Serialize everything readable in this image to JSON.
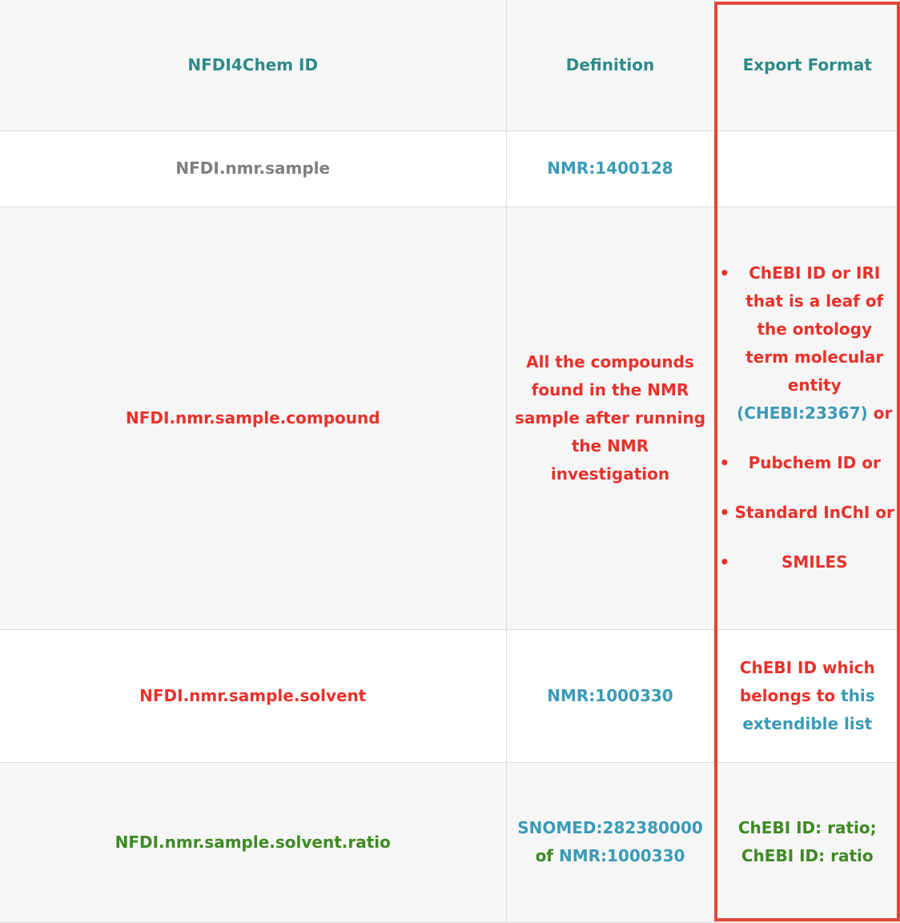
{
  "headers": {
    "col1": "NFDI4Chem ID",
    "col2": "Definition",
    "col3": "Export Format"
  },
  "rows": [
    {
      "id": "NFDI.nmr.sample",
      "definition": "NMR:1400128",
      "export": ""
    },
    {
      "id": "NFDI.nmr.sample.compound",
      "definition": "All the compounds found in the NMR sample after running the NMR investigation",
      "export_items": [
        {
          "text": "ChEBI ID or IRI that is a leaf of the ontology term molecular entity",
          "link": "(CHEBI:23367)",
          "suffix": "or"
        },
        {
          "text": "Pubchem ID or"
        },
        {
          "text": "Standard InChI or"
        },
        {
          "text": "SMILES"
        }
      ]
    },
    {
      "id": "NFDI.nmr.sample.solvent",
      "definition": "NMR:1000330",
      "export_text": "ChEBI ID which belongs to",
      "export_link": "this extendible list"
    },
    {
      "id": "NFDI.nmr.sample.solvent.ratio",
      "definition_link1": "SNOMED:282380000",
      "definition_mid": "of",
      "definition_link2": "NMR:1000330",
      "export": "ChEBI ID: ratio; ChEBI ID: ratio"
    }
  ],
  "bullet": "•",
  "colors": {
    "header": "#2e8a8a",
    "link": "#3a9ab8",
    "grey": "#7f7f7f",
    "red": "#e8312a",
    "green": "#3d8a23",
    "highlight": "#e0463b"
  }
}
